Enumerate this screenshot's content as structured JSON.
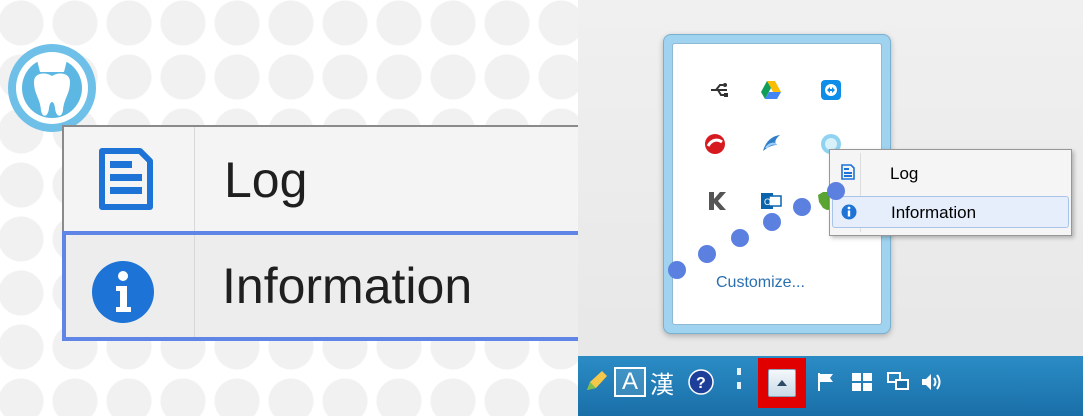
{
  "menu": {
    "items": [
      {
        "label": "Log",
        "icon": "log-document-icon"
      },
      {
        "label": "Information",
        "icon": "info-icon"
      }
    ],
    "highlighted": "Information"
  },
  "tray_popup": {
    "customize_label": "Customize...",
    "icons": [
      "usb-icon",
      "google-drive-icon",
      "teamviewer-icon",
      "trendmicro-icon",
      "dolphin-icon",
      "app-globe-icon",
      "kaspersky-icon",
      "outlook-icon",
      "evernote-icon"
    ]
  },
  "taskbar": {
    "ime_mode_label": "A",
    "ime_kanji_label": "漢",
    "icons": [
      "pen-icon",
      "ime-mode-icon",
      "ime-kanji-icon",
      "help-icon",
      "tray-chevron-icon",
      "show-hidden-icons-button",
      "action-center-flag-icon",
      "windows-grid-icon",
      "network-icon",
      "volume-icon"
    ]
  },
  "colors": {
    "accent": "#5f86e6",
    "callout": "#5b80e0",
    "highlight_box": "#e00000",
    "taskbar": "#1a6fa8"
  }
}
